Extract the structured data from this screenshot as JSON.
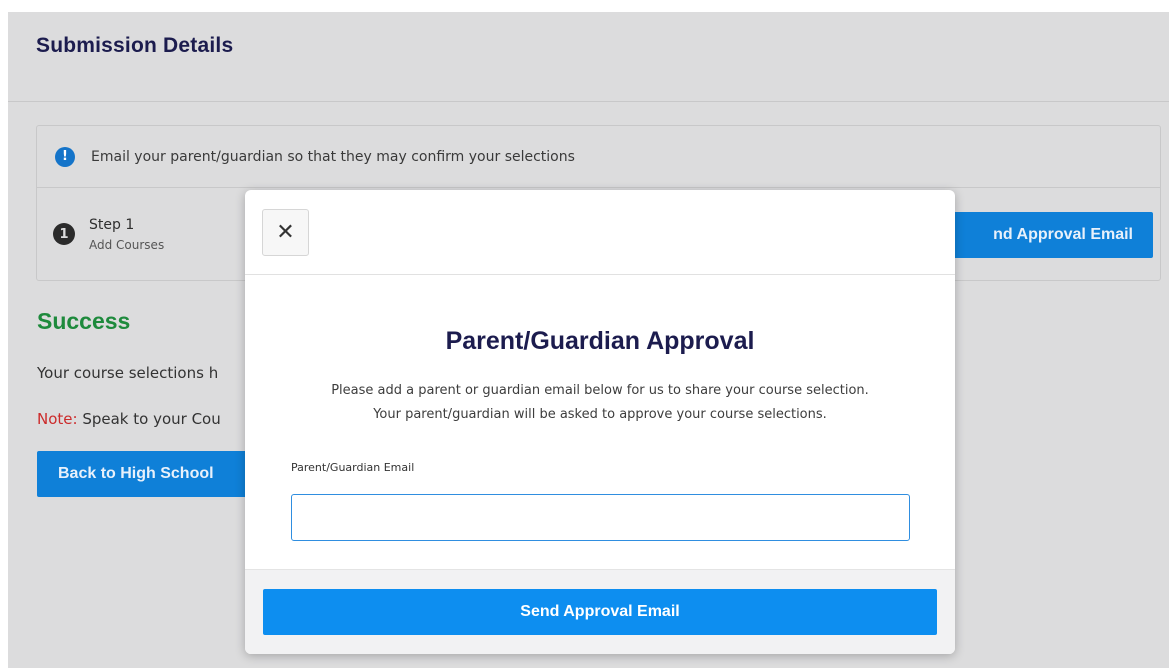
{
  "page": {
    "title": "Submission Details",
    "notice": "Email your parent/guardian so that they may confirm your selections",
    "notice_icon": "!",
    "step": {
      "number": "1",
      "label": "Step 1",
      "sublabel": "Add Courses"
    },
    "background_send_button": "nd Approval Email",
    "success_title": "Success",
    "success_message": "Your course selections h",
    "note_label": "Note:",
    "note_message": " Speak to your Cou",
    "back_button": "Back to High School"
  },
  "modal": {
    "close_icon": "✕",
    "title": "Parent/Guardian Approval",
    "description_line1": "Please add a parent or guardian email below for us to share your course selection.",
    "description_line2": "Your parent/guardian will be asked to approve your course selections.",
    "email_label": "Parent/Guardian Email",
    "email_value": "",
    "submit_button": "Send Approval Email"
  },
  "colors": {
    "primary_button": "#0d8ef0",
    "title_navy": "#1c1c4e",
    "success_green": "#1e8a3c",
    "note_red": "#cc2b2b",
    "overlay_gray": "#dcdcdd"
  }
}
